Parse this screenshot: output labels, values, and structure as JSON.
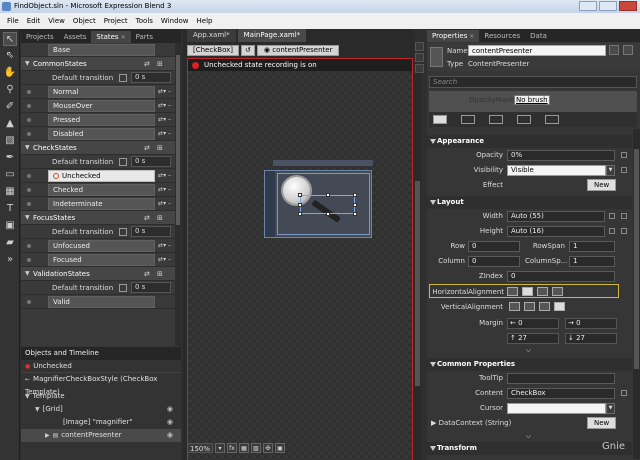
{
  "window": {
    "title": "FindObject.sln - Microsoft Expression Blend 3"
  },
  "menu": [
    "File",
    "Edit",
    "View",
    "Object",
    "Project",
    "Tools",
    "Window",
    "Help"
  ],
  "left_tabs": [
    "Projects",
    "Assets",
    "States",
    "Parts"
  ],
  "states": {
    "base": "Base",
    "groups": [
      {
        "name": "CommonStates",
        "transition": "Default transition",
        "duration": "0 s",
        "items": [
          "Normal",
          "MouseOver",
          "Pressed",
          "Disabled"
        ]
      },
      {
        "name": "CheckStates",
        "transition": "Default transition",
        "duration": "0 s",
        "items": [
          "Unchecked",
          "Checked",
          "Indeterminate"
        ]
      },
      {
        "name": "FocusStates",
        "transition": "Default transition",
        "duration": "0 s",
        "items": [
          "Unfocused",
          "Focused"
        ]
      },
      {
        "name": "ValidationStates",
        "transition": "Default transition",
        "duration": "0 s",
        "items": [
          "Valid"
        ]
      }
    ],
    "selected": "Unchecked"
  },
  "objects": {
    "header": "Objects and Timeline",
    "current_state": "Unchecked",
    "template_label": "MagnifierCheckBoxStyle (CheckBox Template)",
    "tree": [
      "Template",
      "[Grid]",
      "[Image] \"magnifier\"",
      "contentPresenter"
    ]
  },
  "doc_tabs": [
    "App.xaml*",
    "MainPage.xaml*"
  ],
  "breadcrumb": {
    "item1": "[CheckBox]",
    "item3": "contentPresenter"
  },
  "recording": "Unchecked state recording is on",
  "zoom": "150%",
  "right_tabs": [
    "Properties",
    "Resources",
    "Data"
  ],
  "properties": {
    "name_label": "Name",
    "name_value": "contentPresenter",
    "type_label": "Type",
    "type_value": "ContentPresenter",
    "search_placeholder": "Search",
    "opacity_mask_label": "OpacityMask",
    "opacity_mask_value": "No brush",
    "appearance": {
      "title": "Appearance",
      "opacity_label": "Opacity",
      "opacity_value": "0%",
      "visibility_label": "Visibility",
      "visibility_value": "Visible",
      "effect_label": "Effect",
      "new_label": "New"
    },
    "layout": {
      "title": "Layout",
      "width_label": "Width",
      "width_value": "Auto (55)",
      "height_label": "Height",
      "height_value": "Auto (16)",
      "row_label": "Row",
      "row_value": "0",
      "rowspan_label": "RowSpan",
      "rowspan_value": "1",
      "column_label": "Column",
      "column_value": "0",
      "columnspan_label": "ColumnSp...",
      "columnspan_value": "1",
      "zindex_label": "ZIndex",
      "zindex_value": "0",
      "halign_label": "HorizontalAlignment",
      "valign_label": "VerticalAlignment",
      "margin_label": "Margin",
      "margin_values": [
        "0",
        "0",
        "27",
        "27"
      ]
    },
    "common": {
      "title": "Common Properties",
      "tooltip_label": "ToolTip",
      "content_label": "Content",
      "content_value": "CheckBox",
      "cursor_label": "Cursor",
      "datacontext_label": "DataContext (String)",
      "new_label": "New"
    },
    "transform_title": "Transform"
  },
  "watermark": "Gnie"
}
